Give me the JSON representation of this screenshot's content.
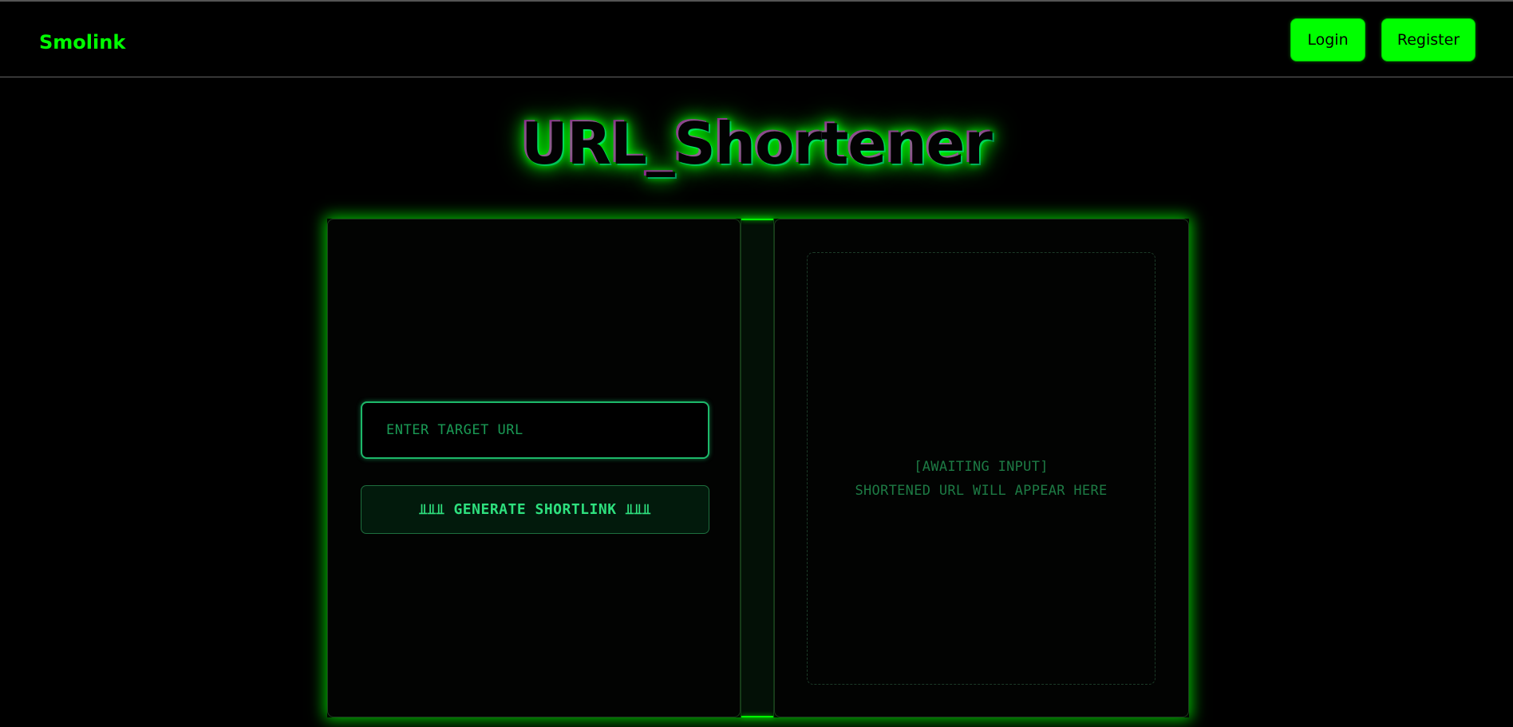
{
  "app": {
    "brand": "Smolink"
  },
  "nav": {
    "login_label": "Login",
    "register_label": "Register"
  },
  "main": {
    "title": "URL_Shortener"
  },
  "form": {
    "url_placeholder": "ENTER TARGET URL",
    "url_value": "",
    "generate_label": "⫫⫫⫫ GENERATE SHORTLINK ⫫⫫⫫"
  },
  "output": {
    "status_line": "[AWAITING INPUT]",
    "hint_line": "SHORTENED URL WILL APPEAR HERE"
  },
  "colors": {
    "accent": "#00ff00",
    "accent_soft": "#2ee07e",
    "background": "#000000"
  }
}
